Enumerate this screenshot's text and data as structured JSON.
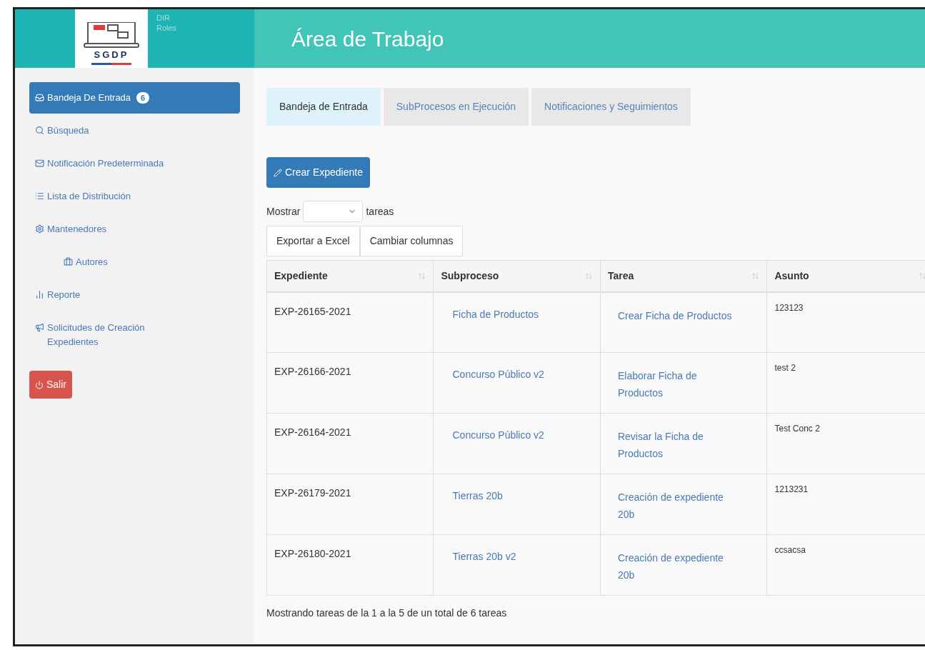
{
  "header": {
    "logo_text": "SGDP",
    "user_lines": [
      "DIR",
      "Roles"
    ],
    "title": "Área de Trabajo"
  },
  "sidebar": {
    "items": [
      {
        "label": "Bandeja De Entrada",
        "badge": "6",
        "selected": true
      },
      {
        "label": "Búsqueda",
        "selected": false
      },
      {
        "label": "Notificación Predeterminada",
        "selected": false
      },
      {
        "label": "Lista de Distribución",
        "selected": false
      },
      {
        "label": "Mantenedores",
        "selected": false,
        "children": [
          {
            "label": "Autores",
            "selected": false
          }
        ]
      },
      {
        "label": "Reporte",
        "selected": false
      },
      {
        "label": "Solicitudes de Creación Expedientes",
        "selected": false
      }
    ],
    "logout": "Salir"
  },
  "tabs": [
    {
      "label": "Bandeja de Entrada",
      "selected": true
    },
    {
      "label": "SubProcesos en Ejecución",
      "selected": false
    },
    {
      "label": "Notificaciones y Seguimientos",
      "selected": false
    }
  ],
  "create_button": "Crear Expediente",
  "length": {
    "before": "Mostrar",
    "after": "tareas"
  },
  "table_buttons": [
    "Exportar a Excel",
    "Cambiar columnas"
  ],
  "table": {
    "columns": [
      "Expediente",
      "Subproceso",
      "Tarea",
      "Asunto"
    ],
    "rows": [
      [
        "EXP-26165-2021",
        "Ficha de Productos",
        "Crear Ficha de Productos",
        "123123"
      ],
      [
        "EXP-26166-2021",
        "Concurso Público v2",
        "Elaborar Ficha de Productos",
        "test 2"
      ],
      [
        "EXP-26164-2021",
        "Concurso Público v2",
        "Revisar la Ficha de Productos",
        "Test Conc 2"
      ],
      [
        "EXP-26179-2021",
        "Tierras 20b",
        "Creación de expediente 20b",
        "1213231"
      ],
      [
        "EXP-26180-2021",
        "Tierras 20b v2",
        "Creación de expediente 20b",
        "ccsacsa"
      ]
    ]
  },
  "info": "Mostrando tareas de la 1 a la 5 de un total de 6 tareas"
}
